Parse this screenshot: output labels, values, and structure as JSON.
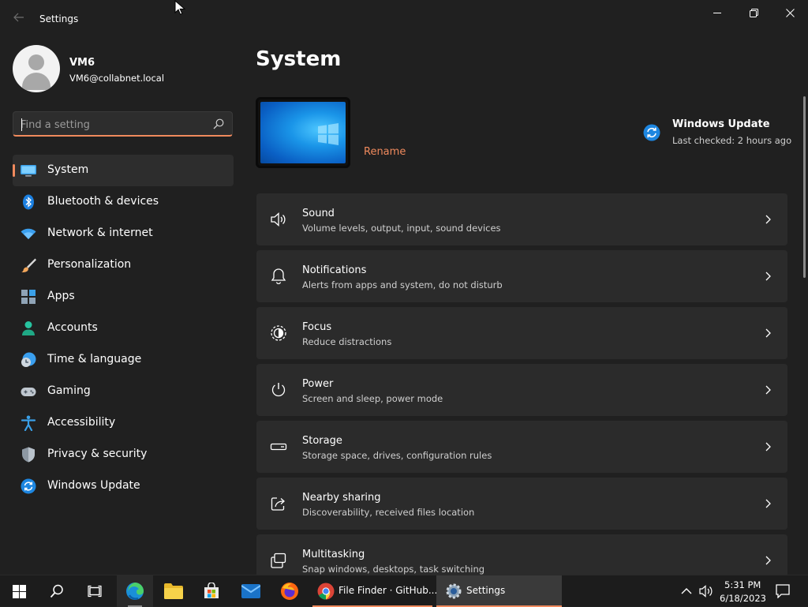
{
  "window": {
    "title": "Settings",
    "back_icon": "back-arrow-icon",
    "controls": [
      "minimize-icon",
      "maximize-icon",
      "close-icon"
    ]
  },
  "profile": {
    "name": "VM6",
    "email": "VM6@collabnet.local"
  },
  "search": {
    "placeholder": "Find a setting",
    "value": ""
  },
  "sidebar": {
    "items": [
      {
        "label": "System",
        "icon": "system-display-icon",
        "active": true
      },
      {
        "label": "Bluetooth & devices",
        "icon": "bluetooth-icon",
        "active": false
      },
      {
        "label": "Network & internet",
        "icon": "wifi-icon",
        "active": false
      },
      {
        "label": "Personalization",
        "icon": "paintbrush-icon",
        "active": false
      },
      {
        "label": "Apps",
        "icon": "apps-icon",
        "active": false
      },
      {
        "label": "Accounts",
        "icon": "accounts-icon",
        "active": false
      },
      {
        "label": "Time & language",
        "icon": "time-language-icon",
        "active": false
      },
      {
        "label": "Gaming",
        "icon": "gamepad-icon",
        "active": false
      },
      {
        "label": "Accessibility",
        "icon": "accessibility-icon",
        "active": false
      },
      {
        "label": "Privacy & security",
        "icon": "shield-icon",
        "active": false
      },
      {
        "label": "Windows Update",
        "icon": "windows-update-icon",
        "active": false
      }
    ]
  },
  "main": {
    "title": "System",
    "rename_label": "Rename",
    "windows_update": {
      "title": "Windows Update",
      "subtitle": "Last checked: 2 hours ago"
    },
    "cards": [
      {
        "title": "Sound",
        "subtitle": "Volume levels, output, input, sound devices",
        "icon": "speaker-icon"
      },
      {
        "title": "Notifications",
        "subtitle": "Alerts from apps and system, do not disturb",
        "icon": "bell-icon"
      },
      {
        "title": "Focus",
        "subtitle": "Reduce distractions",
        "icon": "focus-icon"
      },
      {
        "title": "Power",
        "subtitle": "Screen and sleep, power mode",
        "icon": "power-icon"
      },
      {
        "title": "Storage",
        "subtitle": "Storage space, drives, configuration rules",
        "icon": "storage-icon"
      },
      {
        "title": "Nearby sharing",
        "subtitle": "Discoverability, received files location",
        "icon": "share-icon"
      },
      {
        "title": "Multitasking",
        "subtitle": "Snap windows, desktops, task switching",
        "icon": "multitasking-icon"
      }
    ]
  },
  "taskbar": {
    "chrome_label": "File Finder · GitHub...",
    "settings_label": "Settings",
    "time": "5:31 PM",
    "date": "6/18/2023"
  },
  "colors": {
    "accent": "#f08a5d",
    "background": "#202020",
    "card": "#2b2b2b"
  }
}
